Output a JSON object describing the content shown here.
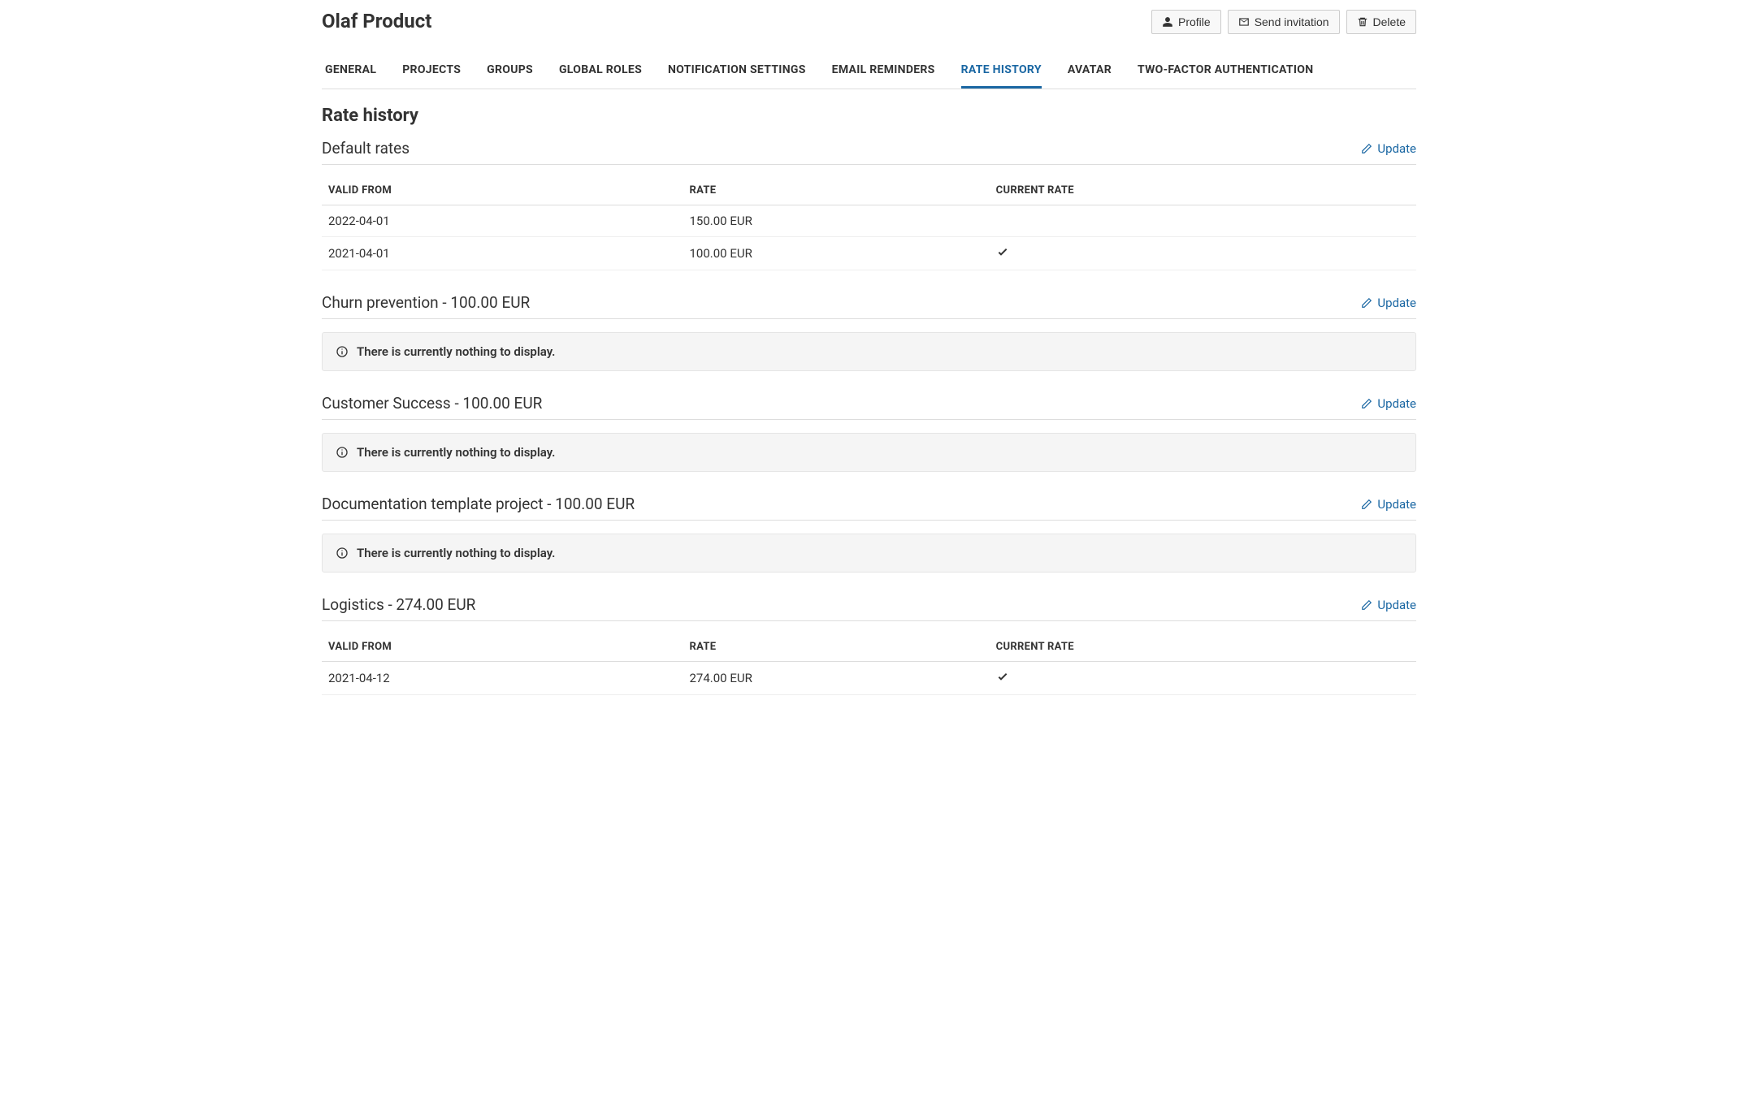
{
  "page": {
    "title": "Olaf Product",
    "section_heading": "Rate history"
  },
  "toolbar": {
    "profile_label": "Profile",
    "send_invitation_label": "Send invitation",
    "delete_label": "Delete"
  },
  "tabs": [
    {
      "label": "GENERAL",
      "active": false
    },
    {
      "label": "PROJECTS",
      "active": false
    },
    {
      "label": "GROUPS",
      "active": false
    },
    {
      "label": "GLOBAL ROLES",
      "active": false
    },
    {
      "label": "NOTIFICATION SETTINGS",
      "active": false
    },
    {
      "label": "EMAIL REMINDERS",
      "active": false
    },
    {
      "label": "RATE HISTORY",
      "active": true
    },
    {
      "label": "AVATAR",
      "active": false
    },
    {
      "label": "TWO-FACTOR AUTHENTICATION",
      "active": false
    }
  ],
  "columns": {
    "valid_from": "VALID FROM",
    "rate": "RATE",
    "current_rate": "CURRENT RATE"
  },
  "empty_message": "There is currently nothing to display.",
  "update_label": "Update",
  "sections": [
    {
      "title": "Default rates",
      "rows": [
        {
          "valid_from": "2022-04-01",
          "rate": "150.00 EUR",
          "current": false
        },
        {
          "valid_from": "2021-04-01",
          "rate": "100.00 EUR",
          "current": true
        }
      ]
    },
    {
      "title": "Churn prevention - 100.00 EUR",
      "rows": []
    },
    {
      "title": "Customer Success - 100.00 EUR",
      "rows": []
    },
    {
      "title": "Documentation template project - 100.00 EUR",
      "rows": []
    },
    {
      "title": "Logistics - 274.00 EUR",
      "rows": [
        {
          "valid_from": "2021-04-12",
          "rate": "274.00 EUR",
          "current": true
        }
      ]
    }
  ]
}
